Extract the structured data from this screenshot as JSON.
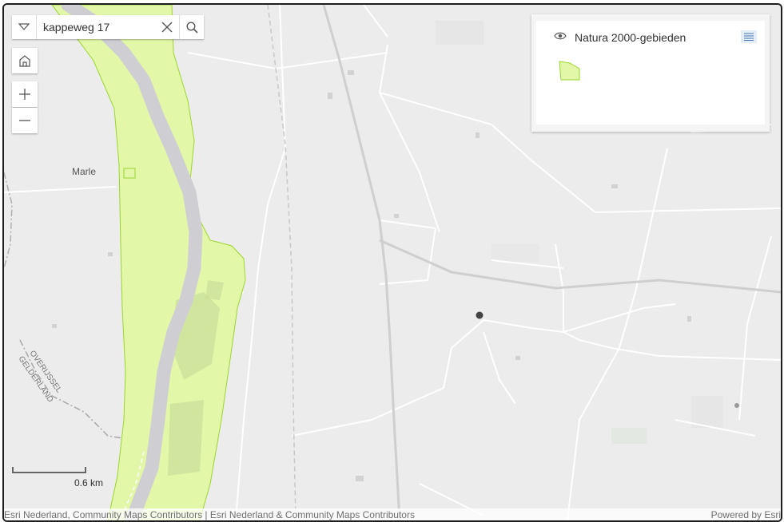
{
  "search": {
    "value": "kappeweg 17"
  },
  "map": {
    "place_label": "Marle",
    "province_label_1": "OVERIJSSEL",
    "province_label_2": "GELDERLAND",
    "natura_fill": "#e2f8a8",
    "natura_stroke": "#9cd52f",
    "river_color": "#cfcfd3",
    "background": "#ececec",
    "marker_color": "#444444"
  },
  "legend": {
    "layer_title": "Natura 2000-gebieden",
    "eye_icon": "eye-icon",
    "list_icon": "list-icon"
  },
  "scale": {
    "label": "0.6 km"
  },
  "attribution": {
    "left": "Esri Nederland, Community Maps Contributors | Esri Nederland & Community Maps Contributors",
    "right": "Powered by Esri"
  },
  "controls": {
    "home_icon": "home-icon",
    "zoom_in_icon": "plus-icon",
    "zoom_out_icon": "minus-icon",
    "dropdown_icon": "chevron-down-icon",
    "clear_icon": "close-icon",
    "search_icon": "search-icon"
  }
}
